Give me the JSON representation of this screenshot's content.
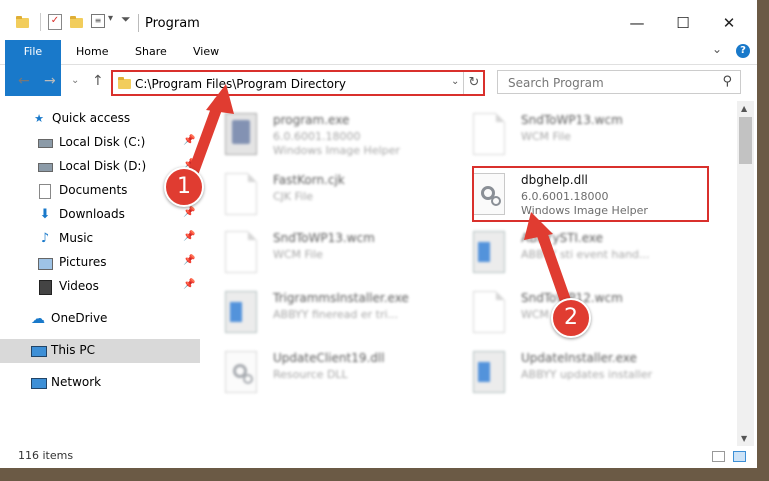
{
  "window": {
    "title": "Program",
    "controls": {
      "minimize": "—",
      "maximize": "☐",
      "close": "✕"
    }
  },
  "ribbon": {
    "tabs": [
      "File",
      "Home",
      "Share",
      "View"
    ],
    "help": "?",
    "expand": "⌄"
  },
  "navigation": {
    "back": "←",
    "forward": "→",
    "recent": "⌄",
    "up": "↑",
    "address": "C:\\Program Files\\Program Directory",
    "search_placeholder": "Search Program"
  },
  "sidebar": {
    "items": [
      {
        "label": "Quick access",
        "icon": "star-icon"
      },
      {
        "label": "Local Disk (C:)",
        "icon": "drive-icon",
        "pinned": true
      },
      {
        "label": "Local Disk (D:)",
        "icon": "drive-icon",
        "pinned": true
      },
      {
        "label": "Documents",
        "icon": "documents-icon",
        "pinned": true
      },
      {
        "label": "Downloads",
        "icon": "download-icon",
        "pinned": true
      },
      {
        "label": "Music",
        "icon": "music-icon",
        "pinned": true
      },
      {
        "label": "Pictures",
        "icon": "pictures-icon",
        "pinned": true
      },
      {
        "label": "Videos",
        "icon": "videos-icon",
        "pinned": true
      },
      {
        "label": "OneDrive",
        "icon": "cloud-icon"
      },
      {
        "label": "This PC",
        "icon": "computer-icon",
        "selected": true
      },
      {
        "label": "Network",
        "icon": "network-icon"
      }
    ]
  },
  "files": [
    {
      "name": "program.exe",
      "type": "6.0.6001.18000",
      "desc": "Windows Image Helper",
      "icon": "exe-icon"
    },
    {
      "name": "SndToWP13.wcm",
      "type": "WCM File",
      "desc": "",
      "icon": "document-icon"
    },
    {
      "name": "FastKorn.cjk",
      "type": "CJK File",
      "desc": "",
      "icon": "document-icon"
    },
    {
      "name": "dbghelp.dll",
      "type": "6.0.6001.18000",
      "desc": "Windows Image Helper",
      "icon": "gear-document-icon"
    },
    {
      "name": "SndToWP13.wcm",
      "type": "WCM File",
      "desc": "",
      "icon": "document-icon"
    },
    {
      "name": "ABBYySTI.exe",
      "type": "ABBYY sti event hand...",
      "desc": "",
      "icon": "app-icon"
    },
    {
      "name": "TrigrammsInstaller.exe",
      "type": "ABBYY fineread er tri...",
      "desc": "",
      "icon": "app-icon"
    },
    {
      "name": "SndToWP12.wcm",
      "type": "WCM File",
      "desc": "",
      "icon": "document-icon"
    },
    {
      "name": "UpdateClient19.dll",
      "type": "Resource DLL",
      "desc": "",
      "icon": "gear-document-icon"
    },
    {
      "name": "UpdateInstaller.exe",
      "type": "ABBYY updates installer",
      "desc": "",
      "icon": "app-icon"
    }
  ],
  "status": {
    "count": "116 items"
  },
  "callouts": [
    "1",
    "2"
  ],
  "colors": {
    "accent": "#1979ca",
    "highlight": "#d9302c",
    "callout": "#e03c31"
  }
}
